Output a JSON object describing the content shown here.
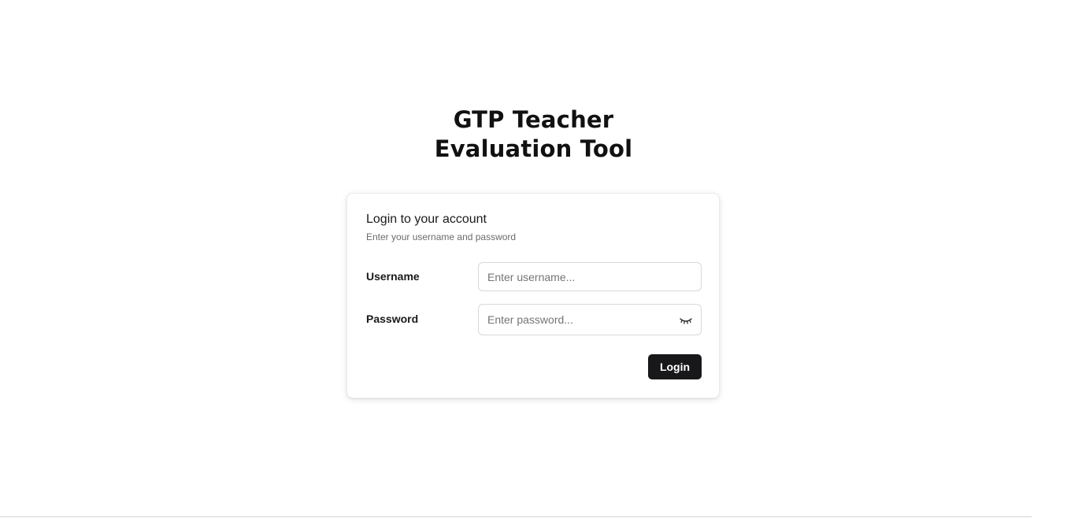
{
  "app": {
    "title_line1": "GTP Teacher",
    "title_line2": "Evaluation Tool"
  },
  "login_card": {
    "title": "Login to your account",
    "subtitle": "Enter your username and password",
    "username": {
      "label": "Username",
      "placeholder": "Enter username...",
      "value": ""
    },
    "password": {
      "label": "Password",
      "placeholder": "Enter password...",
      "value": "",
      "toggle_icon": "eye-closed-icon"
    },
    "submit_label": "Login"
  },
  "colors": {
    "primary_button": "#18181b",
    "muted_text": "#6b6b6b",
    "input_border": "#d9d9d9"
  }
}
